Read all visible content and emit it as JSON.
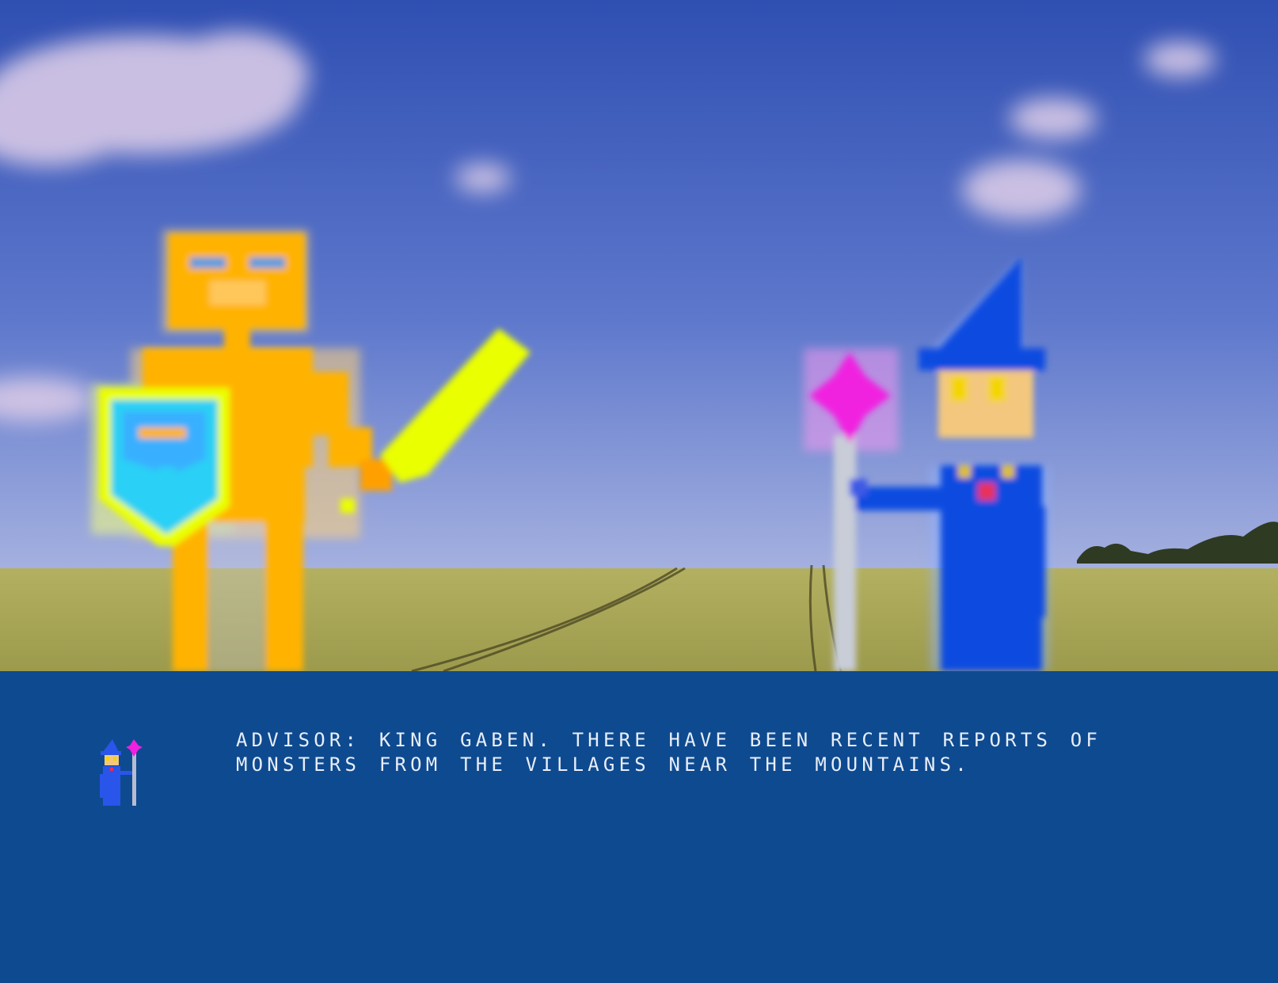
{
  "scene": {
    "background": "sky-over-wheat-field",
    "colors": {
      "sky_top": "#3457b8",
      "sky_bottom": "#a0aee0",
      "field": "#a7a552",
      "knight_body": "#ffb300",
      "sword": "#eaff00",
      "shield": "#2bd0f5",
      "wizard_robe": "#0f4be0",
      "wizard_face": "#f3c87e",
      "staff_gem": "#f020e0"
    },
    "characters": [
      {
        "name": "knight",
        "icon": "knight-sprite"
      },
      {
        "name": "advisor",
        "icon": "wizard-sprite"
      }
    ]
  },
  "dialog": {
    "speaker": "ADVISOR:",
    "text": "KING GABEN. THERE HAVE BEEN RECENT REPORTS OF MONSTERS FROM THE VILLAGES NEAR THE MOUNTAINS.",
    "portrait_icon": "wizard-portrait-icon",
    "background_color": "#0e4a8f",
    "text_color": "#e8eef8"
  }
}
